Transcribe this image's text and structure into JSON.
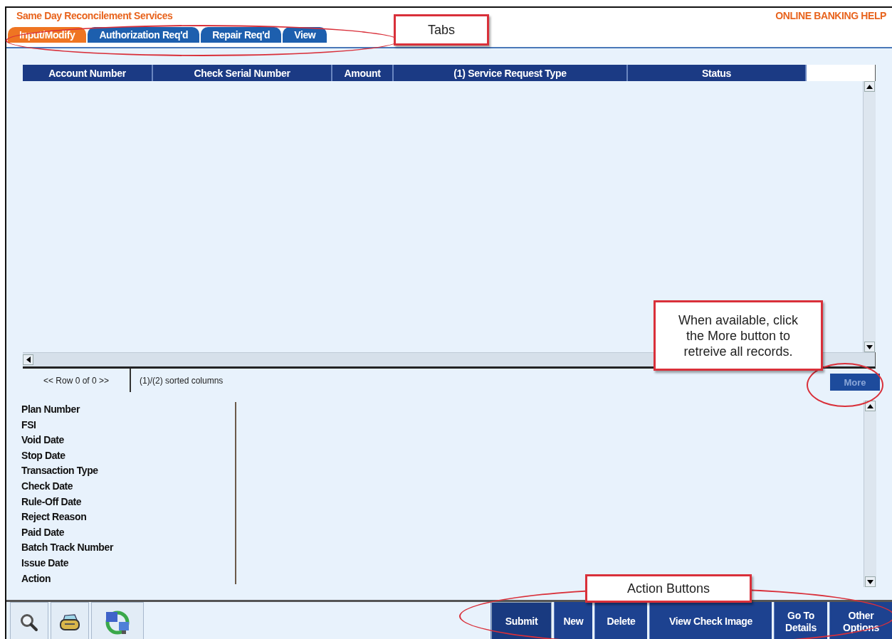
{
  "header": {
    "title": "Same Day Reconcilement Services",
    "help_link": "ONLINE BANKING HELP"
  },
  "tabs": [
    {
      "label": "Input/Modify",
      "selected": true
    },
    {
      "label": "Authorization Req'd",
      "selected": false
    },
    {
      "label": "Repair Req'd",
      "selected": false
    },
    {
      "label": "View",
      "selected": false
    }
  ],
  "grid": {
    "columns": [
      "Account Number",
      "Check Serial Number",
      "Amount",
      "(1) Service Request Type",
      "Status"
    ],
    "row_status": "<< Row 0 of 0 >>",
    "sort_note": "(1)/(2) sorted columns",
    "more_button": "More"
  },
  "detail_fields": [
    "Plan Number",
    "FSI",
    "Void Date",
    "Stop Date",
    "Transaction Type",
    "Check Date",
    "Rule-Off Date",
    "Reject Reason",
    "Paid Date",
    "Batch Track Number",
    "Issue Date",
    "Action"
  ],
  "action_buttons": [
    {
      "label": "Submit",
      "selected": true
    },
    {
      "label": "New",
      "selected": false
    },
    {
      "label": "Delete",
      "selected": false
    },
    {
      "label": "View Check Image",
      "selected": false
    },
    {
      "label": "Go To Details",
      "selected": false
    },
    {
      "label": "Other Options",
      "selected": false
    }
  ],
  "annotations": [
    "Tabs",
    "When available, click the More button to retreive all records.",
    "Action Buttons"
  ]
}
